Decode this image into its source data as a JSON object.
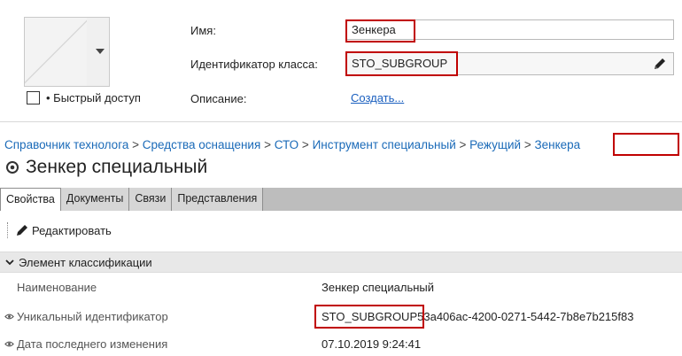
{
  "form": {
    "quick_access_label": "• Быстрый доступ",
    "name_label": "Имя:",
    "name_value": "Зенкера",
    "class_id_label": "Идентификатор класса:",
    "class_id_value": "STO_SUBGROUP",
    "description_label": "Описание:",
    "description_link": "Создать..."
  },
  "breadcrumb": {
    "items": [
      "Справочник технолога",
      "Средства оснащения",
      "СТО",
      "Инструмент специальный",
      "Режущий",
      "Зенкера"
    ],
    "separator": ">"
  },
  "title": "Зенкер специальный",
  "tabs": [
    "Свойства",
    "Документы",
    "Связи",
    "Представления"
  ],
  "toolbar": {
    "edit_label": "Редактировать"
  },
  "section": {
    "label": "Элемент классификации"
  },
  "properties": [
    {
      "name": "Наименование",
      "value": "Зенкер специальный"
    },
    {
      "name": "Уникальный идентификатор",
      "value_highlight": "STO_SUBGROUP",
      "value_rest": "53a406ac-4200-0271-5442-7b8e7b215f83"
    },
    {
      "name": "Дата последнего изменения",
      "value": "07.10.2019 9:24:41"
    }
  ],
  "colors": {
    "highlight": "#c00000",
    "link": "#1a6ab8",
    "tabbar": "#bdbdbd",
    "section": "#e8e8e8"
  }
}
